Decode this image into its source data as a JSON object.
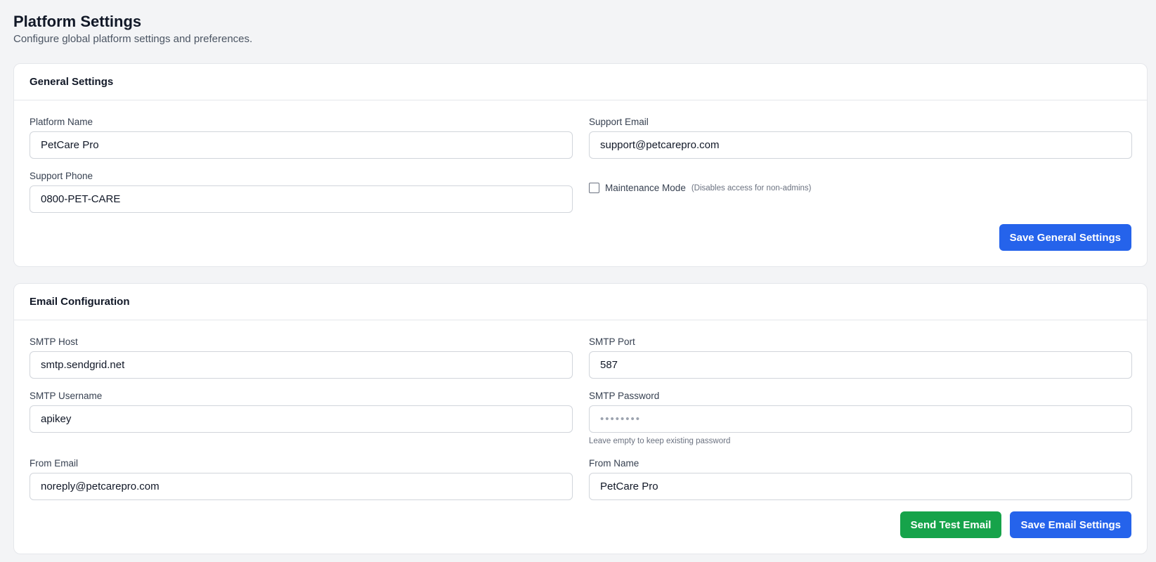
{
  "header": {
    "title": "Platform Settings",
    "subtitle": "Configure global platform settings and preferences."
  },
  "general": {
    "title": "General Settings",
    "platform_name_label": "Platform Name",
    "platform_name_value": "PetCare Pro",
    "support_email_label": "Support Email",
    "support_email_value": "support@petcarepro.com",
    "support_phone_label": "Support Phone",
    "support_phone_value": "0800-PET-CARE",
    "maintenance_label": "Maintenance Mode",
    "maintenance_hint": "(Disables access for non-admins)",
    "maintenance_checked": false,
    "save_label": "Save General Settings"
  },
  "email": {
    "title": "Email Configuration",
    "smtp_host_label": "SMTP Host",
    "smtp_host_value": "smtp.sendgrid.net",
    "smtp_port_label": "SMTP Port",
    "smtp_port_value": "587",
    "smtp_username_label": "SMTP Username",
    "smtp_username_value": "apikey",
    "smtp_password_label": "SMTP Password",
    "smtp_password_placeholder": "••••••••",
    "smtp_password_hint": "Leave empty to keep existing password",
    "from_email_label": "From Email",
    "from_email_value": "noreply@petcarepro.com",
    "from_name_label": "From Name",
    "from_name_value": "PetCare Pro",
    "test_label": "Send Test Email",
    "save_label": "Save Email Settings"
  },
  "colors": {
    "primary": "#2563eb",
    "success": "#16a34a",
    "background": "#f3f4f6"
  }
}
